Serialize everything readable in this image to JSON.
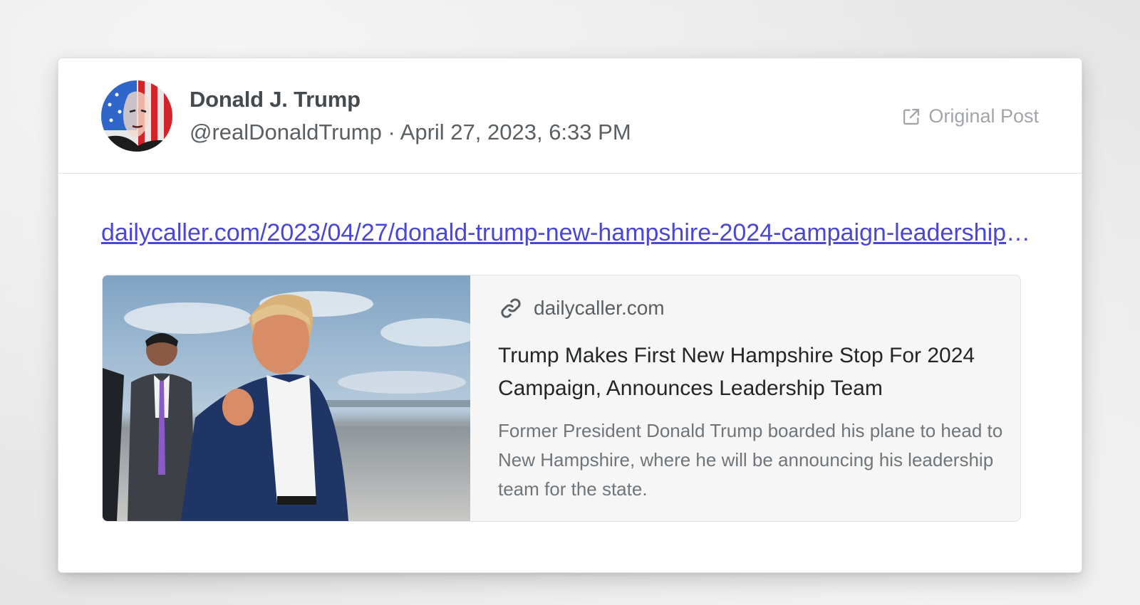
{
  "post": {
    "display_name": "Donald J. Trump",
    "handle": "@realDonaldTrump",
    "separator": "·",
    "timestamp": "April 27, 2023, 6:33 PM",
    "original_post_label": "Original Post",
    "link_text": "dailycaller.com/2023/04/27/donald-trump-new-hampshire-2024-campaign-leadership-team",
    "link_color": "#4a46d6"
  },
  "link_preview": {
    "domain": "dailycaller.com",
    "title": "Trump Makes First New Hampshire Stop For 2024 Campaign, Announces Leadership Team",
    "description": "Former President Donald Trump boarded his plane to head to New Hampshire, where he will be announcing his leadership team for the state."
  },
  "icons": {
    "external": "external-link-icon",
    "chain": "link-chain-icon"
  }
}
